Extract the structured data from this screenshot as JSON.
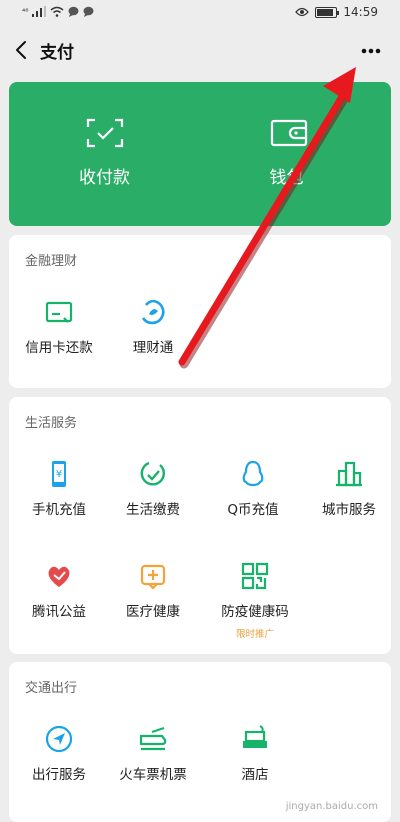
{
  "status_bar": {
    "network": "⁴⁶",
    "time": "14:59"
  },
  "nav": {
    "title": "支付"
  },
  "top_actions": [
    {
      "label": "收付款",
      "icon": "scan-frame-icon"
    },
    {
      "label": "钱包",
      "icon": "wallet-icon"
    }
  ],
  "finance": {
    "title": "金融理财",
    "items": [
      {
        "label": "信用卡还款",
        "icon": "credit-card-icon"
      },
      {
        "label": "理财通",
        "icon": "wealth-icon"
      }
    ]
  },
  "life": {
    "title": "生活服务",
    "items": [
      {
        "label": "手机充值",
        "icon": "phone-topup-icon"
      },
      {
        "label": "生活缴费",
        "icon": "utility-bill-icon"
      },
      {
        "label": "Q币充值",
        "icon": "qq-penguin-icon"
      },
      {
        "label": "城市服务",
        "icon": "city-building-icon"
      },
      {
        "label": "腾讯公益",
        "icon": "charity-heart-icon"
      },
      {
        "label": "医疗健康",
        "icon": "medical-icon"
      },
      {
        "label": "防疫健康码",
        "icon": "qr-code-icon",
        "badge": "限时推广"
      }
    ]
  },
  "travel": {
    "title": "交通出行",
    "items": [
      {
        "label": "出行服务",
        "icon": "navigation-arrow-icon"
      },
      {
        "label": "火车票机票",
        "icon": "train-icon"
      },
      {
        "label": "酒店",
        "icon": "hotel-bed-icon"
      }
    ]
  },
  "watermark": "jingyan.baidu.com",
  "colors": {
    "green": "#2aae67",
    "blue": "#1aa3e8",
    "teal": "#17b36b",
    "red": "#e54b4b",
    "orange": "#f4a33b",
    "arrow": "#e8191e"
  }
}
